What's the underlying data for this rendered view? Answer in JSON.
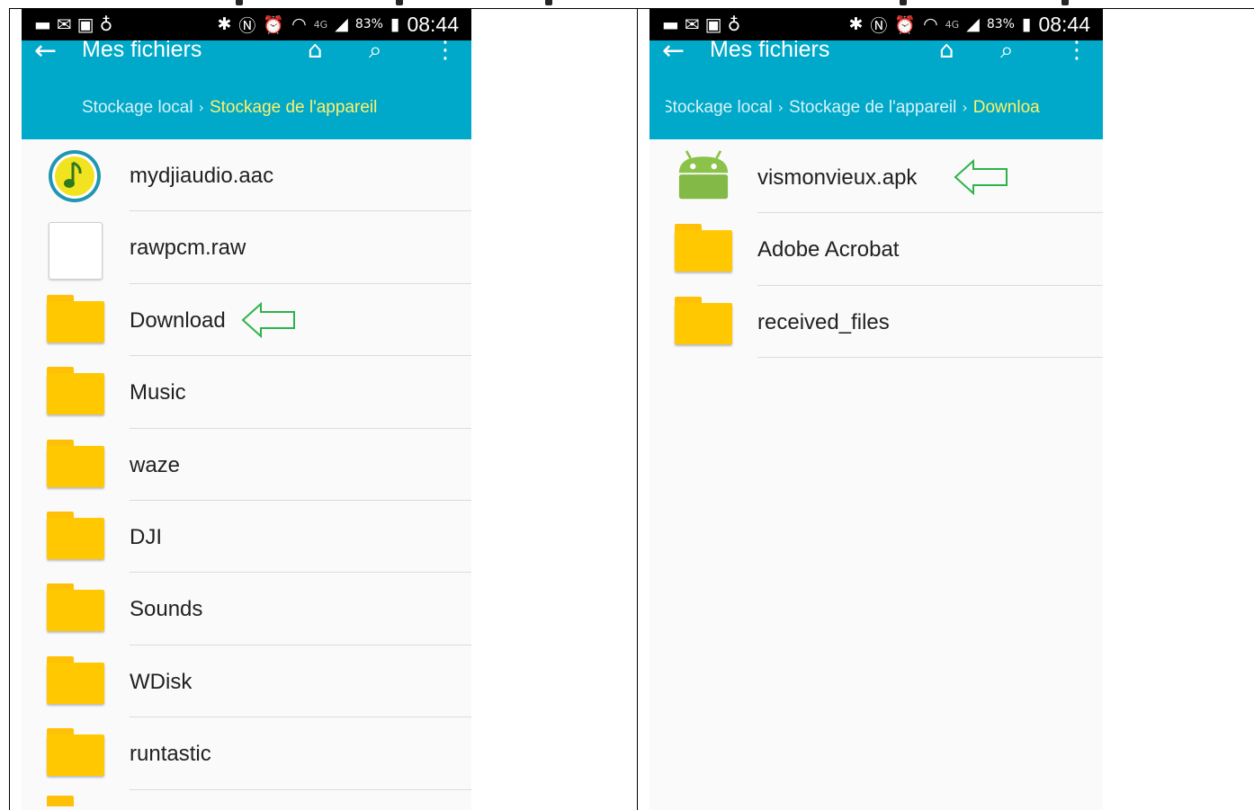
{
  "status_bar": {
    "left_icons": [
      "message-icon",
      "mail-icon",
      "gallery-icon",
      "mic-icon"
    ],
    "right_icons": [
      "bluetooth-icon",
      "nfc-icon",
      "alarm-icon",
      "wifi-icon"
    ],
    "network": "4G",
    "battery": "83%",
    "time": "08:44"
  },
  "left_panel": {
    "title": "Mes fichiers",
    "breadcrumb": [
      {
        "label": "Stockage local"
      },
      {
        "label": "Stockage de l'appareil"
      }
    ],
    "items": [
      {
        "name": "mydjiaudio.aac",
        "icon": "audio-file-icon"
      },
      {
        "name": "rawpcm.raw",
        "icon": "file-icon"
      },
      {
        "name": "Download",
        "icon": "folder-icon"
      },
      {
        "name": "Music",
        "icon": "folder-icon"
      },
      {
        "name": "waze",
        "icon": "folder-icon"
      },
      {
        "name": "DJI",
        "icon": "folder-icon"
      },
      {
        "name": "Sounds",
        "icon": "folder-icon"
      },
      {
        "name": "WDisk",
        "icon": "folder-icon"
      },
      {
        "name": "runtastic",
        "icon": "folder-icon"
      }
    ]
  },
  "right_panel": {
    "title": "Mes fichiers",
    "breadcrumb": [
      {
        "label": "Stockage local"
      },
      {
        "label": "Stockage de l'appareil"
      },
      {
        "label": "Downloa"
      }
    ],
    "items": [
      {
        "name": "vismonvieux.apk",
        "icon": "android-apk-icon"
      },
      {
        "name": "Adobe Acrobat",
        "icon": "folder-icon"
      },
      {
        "name": "received_files",
        "icon": "folder-icon"
      }
    ]
  },
  "colors": {
    "app_bar": "#00a9c9",
    "breadcrumb_current": "#fff06b",
    "folder": "#ffc800",
    "annotation_arrow": "#2db34a",
    "android_green": "#8bc34a"
  }
}
